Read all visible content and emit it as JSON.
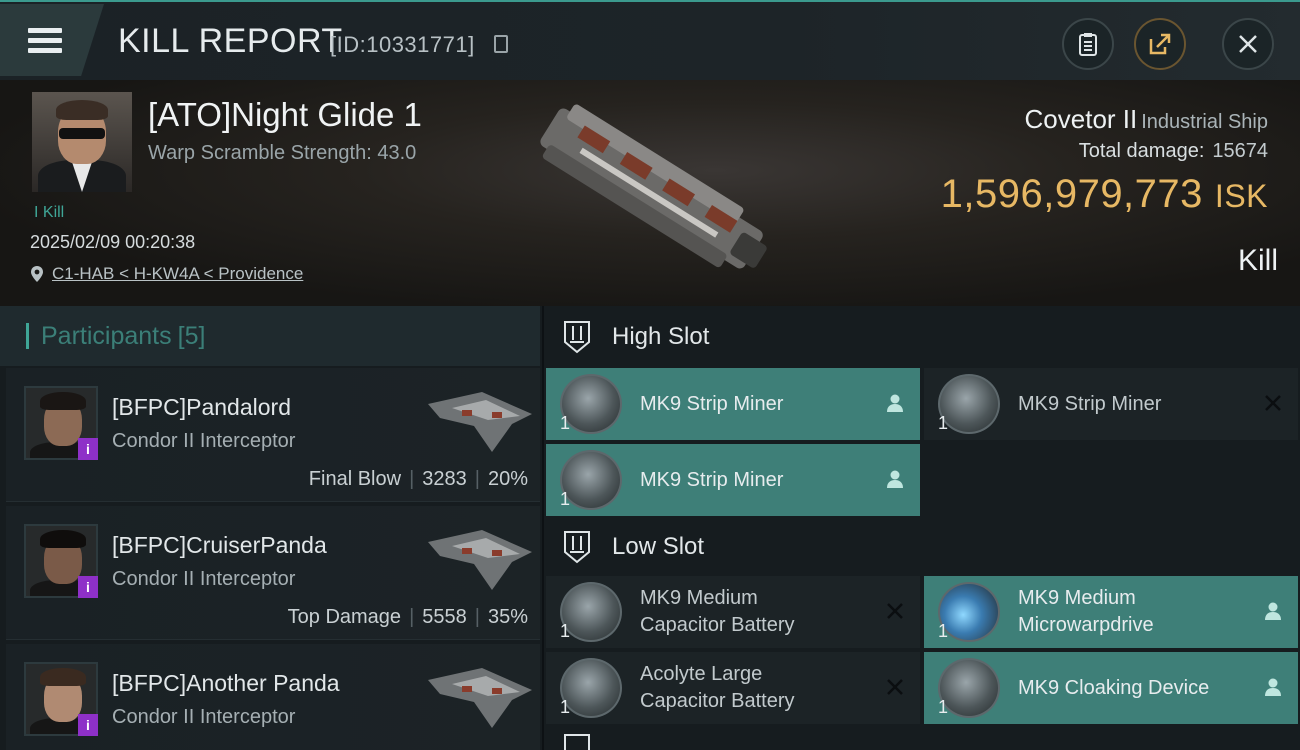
{
  "header": {
    "title": "KILL REPORT",
    "report_id": "[ID:10331771]"
  },
  "victim": {
    "name": "[ATO]Night Glide 1",
    "warp_scramble": "Warp Scramble Strength: 43.0",
    "kill_tag": "Kill",
    "datetime": "2025/02/09 00:20:38",
    "location": "C1-HAB < H-KW4A < Providence",
    "ship_name": "Covetor II",
    "ship_type": "Industrial Ship",
    "total_damage_label": "Total damage:",
    "total_damage": "15674",
    "isk_value": "1,596,979,773",
    "isk_unit": "ISK",
    "result": "Kill"
  },
  "participants": {
    "label": "Participants",
    "count": "[5]",
    "items": [
      {
        "name": "[BFPC]Pandalord",
        "ship": "Condor II Interceptor",
        "role": "Final Blow",
        "damage": "3283",
        "percent": "20%"
      },
      {
        "name": "[BFPC]CruiserPanda",
        "ship": "Condor II Interceptor",
        "role": "Top Damage",
        "damage": "5558",
        "percent": "35%"
      },
      {
        "name": "[BFPC]Another Panda",
        "ship": "Condor II Interceptor",
        "role": "",
        "damage": "",
        "percent": ""
      }
    ]
  },
  "slots": {
    "high": {
      "label": "High Slot",
      "modules": [
        {
          "name": "MK9 Strip Miner",
          "qty": "1",
          "status": "fitted"
        },
        {
          "name": "MK9 Strip Miner",
          "qty": "1",
          "status": "destroyed"
        },
        {
          "name": "MK9 Strip Miner",
          "qty": "1",
          "status": "fitted"
        }
      ]
    },
    "low": {
      "label": "Low Slot",
      "modules": [
        {
          "name_line1": "MK9 Medium",
          "name_line2": "Capacitor Battery",
          "qty": "1",
          "status": "destroyed"
        },
        {
          "name_line1": "MK9 Medium",
          "name_line2": "Microwarpdrive",
          "qty": "1",
          "status": "fitted"
        },
        {
          "name_line1": "Acolyte Large",
          "name_line2": "Capacitor Battery",
          "qty": "1",
          "status": "destroyed"
        },
        {
          "name_line1": "MK9 Cloaking Device",
          "name_line2": "",
          "qty": "1",
          "status": "fitted"
        }
      ]
    }
  },
  "colors": {
    "accent_teal": "#3fa697",
    "fitted_bg": "#3e7f78",
    "isk_gold": "#e7b864",
    "info_badge": "#8e30c8"
  },
  "icons": {
    "menu": "hamburger-icon",
    "copy": "copy-icon",
    "clipboard": "clipboard-icon",
    "share": "share-icon",
    "close": "close-icon",
    "location": "location-pin-icon",
    "slot": "slot-icon",
    "pilot": "pilot-icon",
    "destroyed": "x-mark-icon"
  }
}
